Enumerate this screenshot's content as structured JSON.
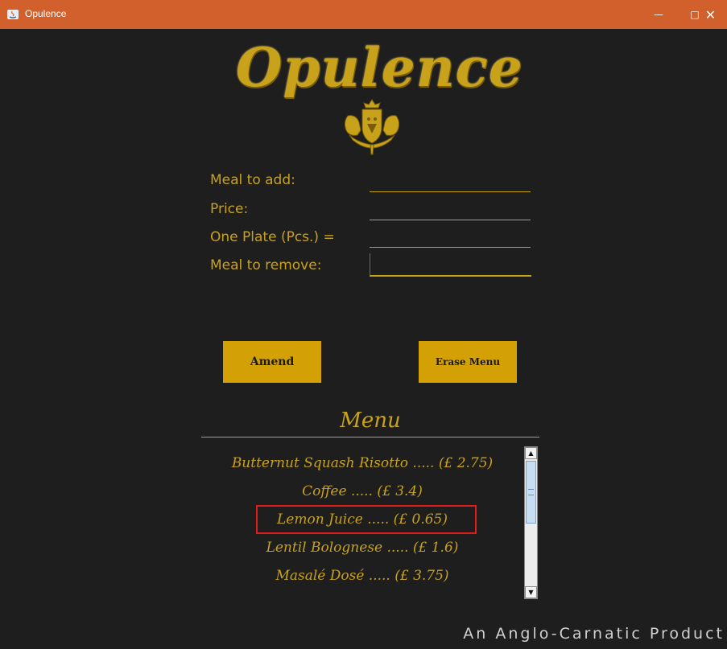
{
  "window": {
    "title": "Opulence",
    "titlebar_color": "#d1602c",
    "background_color": "#1e1e1e",
    "accent_color": "#c9a21c",
    "controls": {
      "minimize": "minimize-icon",
      "maximize": "maximize-icon",
      "close": "close-icon"
    }
  },
  "header": {
    "logo_text": "Opulence",
    "crest_icon": "heraldic-crest-icon"
  },
  "form": {
    "meal_to_add_label": "Meal to add:",
    "meal_to_add_value": "",
    "price_label": "Price:",
    "price_value": "",
    "plate_label": "One Plate (Pcs.) =",
    "plate_value": "",
    "meal_to_remove_label": "Meal to remove:",
    "meal_to_remove_value": ""
  },
  "buttons": {
    "amend_label": "Amend",
    "erase_label": "Erase Menu",
    "color": "#d3a106"
  },
  "menu": {
    "title": "Menu",
    "items": [
      "Butternut Squash Risotto ..... (£ 2.75)",
      "Coffee ..... (£ 3.4)",
      "Lemon Juice ..... (£ 0.65)",
      "Lentil Bolognese ..... (£ 1.6)",
      "Masalé Dosé ..... (£ 3.75)"
    ],
    "highlighted_item_index": 2,
    "highlight_color": "#e31b1b"
  },
  "footer": {
    "text": "An Anglo-Carnatic Product"
  }
}
